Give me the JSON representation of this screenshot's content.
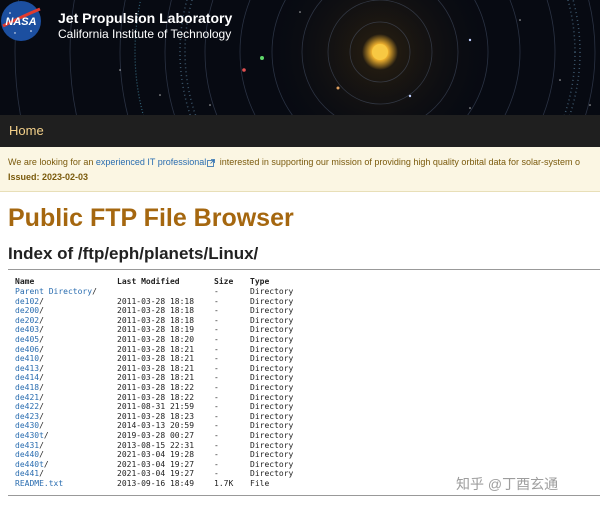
{
  "header": {
    "logo_text": "NASA",
    "title": "Jet Propulsion Laboratory",
    "subtitle": "California Institute of Technology"
  },
  "nav": {
    "home": "Home"
  },
  "notice": {
    "prefix": "We are looking for an ",
    "link": "experienced IT professional",
    "suffix": " interested in supporting our mission of providing high quality orbital data for solar-system o",
    "issued": "Issued: 2023-02-03"
  },
  "page_title": "Public FTP File Browser",
  "index_heading": "Index of /ftp/eph/planets/Linux/",
  "columns": {
    "name": "Name",
    "modified": "Last Modified",
    "size": "Size",
    "type": "Type"
  },
  "rows": [
    {
      "name": "Parent Directory",
      "slash": "/",
      "modified": "",
      "size": "-",
      "type": "Directory"
    },
    {
      "name": "de102",
      "slash": "/",
      "modified": "2011-03-28 18:18",
      "size": "-",
      "type": "Directory"
    },
    {
      "name": "de200",
      "slash": "/",
      "modified": "2011-03-28 18:18",
      "size": "-",
      "type": "Directory"
    },
    {
      "name": "de202",
      "slash": "/",
      "modified": "2011-03-28 18:18",
      "size": "-",
      "type": "Directory"
    },
    {
      "name": "de403",
      "slash": "/",
      "modified": "2011-03-28 18:19",
      "size": "-",
      "type": "Directory"
    },
    {
      "name": "de405",
      "slash": "/",
      "modified": "2011-03-28 18:20",
      "size": "-",
      "type": "Directory"
    },
    {
      "name": "de406",
      "slash": "/",
      "modified": "2011-03-28 18:21",
      "size": "-",
      "type": "Directory"
    },
    {
      "name": "de410",
      "slash": "/",
      "modified": "2011-03-28 18:21",
      "size": "-",
      "type": "Directory"
    },
    {
      "name": "de413",
      "slash": "/",
      "modified": "2011-03-28 18:21",
      "size": "-",
      "type": "Directory"
    },
    {
      "name": "de414",
      "slash": "/",
      "modified": "2011-03-28 18:21",
      "size": "-",
      "type": "Directory"
    },
    {
      "name": "de418",
      "slash": "/",
      "modified": "2011-03-28 18:22",
      "size": "-",
      "type": "Directory"
    },
    {
      "name": "de421",
      "slash": "/",
      "modified": "2011-03-28 18:22",
      "size": "-",
      "type": "Directory"
    },
    {
      "name": "de422",
      "slash": "/",
      "modified": "2011-08-31 21:59",
      "size": "-",
      "type": "Directory"
    },
    {
      "name": "de423",
      "slash": "/",
      "modified": "2011-03-28 18:23",
      "size": "-",
      "type": "Directory"
    },
    {
      "name": "de430",
      "slash": "/",
      "modified": "2014-03-13 20:59",
      "size": "-",
      "type": "Directory"
    },
    {
      "name": "de430t",
      "slash": "/",
      "modified": "2019-03-28 00:27",
      "size": "-",
      "type": "Directory"
    },
    {
      "name": "de431",
      "slash": "/",
      "modified": "2013-08-15 22:31",
      "size": "-",
      "type": "Directory"
    },
    {
      "name": "de440",
      "slash": "/",
      "modified": "2021-03-04 19:28",
      "size": "-",
      "type": "Directory"
    },
    {
      "name": "de440t",
      "slash": "/",
      "modified": "2021-03-04 19:27",
      "size": "-",
      "type": "Directory"
    },
    {
      "name": "de441",
      "slash": "/",
      "modified": "2021-03-04 19:27",
      "size": "-",
      "type": "Directory"
    },
    {
      "name": "README.txt",
      "slash": "",
      "modified": "2013-09-16 18:49",
      "size": "1.7K",
      "type": "File"
    }
  ],
  "watermark": "知乎 @丁酉玄通",
  "colors": {
    "banner_bg": "#070a12",
    "nav_bg": "#1f1f1f",
    "nav_link": "#f3d08a",
    "notice_bg": "#fbf6e3",
    "title": "#a5670f",
    "link": "#2a6db0"
  },
  "icons": {
    "external_link": "external-link-icon"
  }
}
